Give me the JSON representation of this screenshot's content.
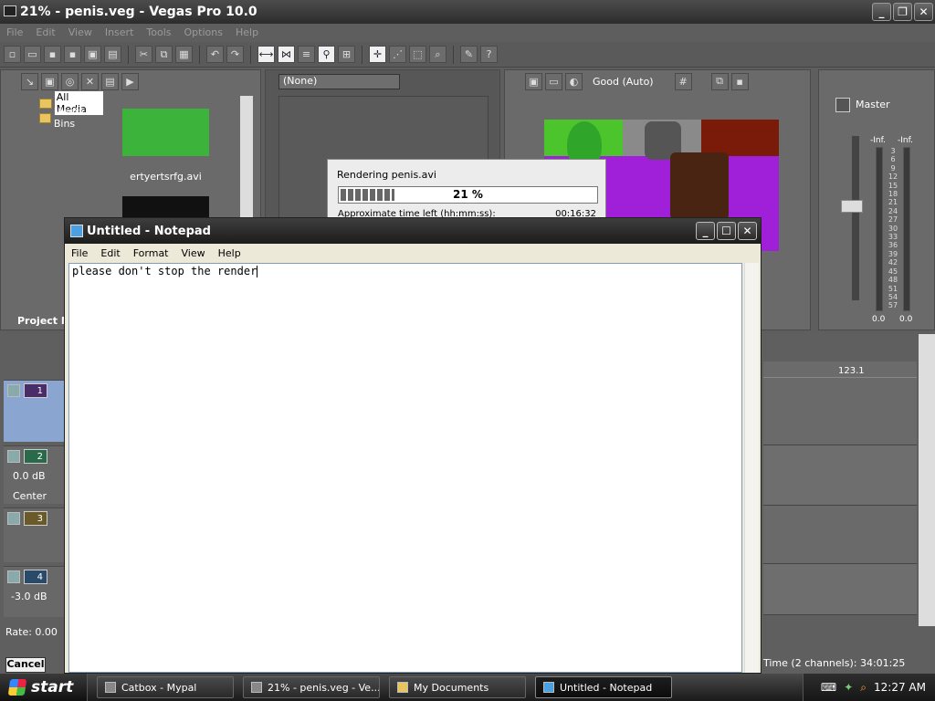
{
  "vegas": {
    "title": "21% - penis.veg - Vegas Pro 10.0",
    "menu": [
      "File",
      "Edit",
      "View",
      "Insert",
      "Tools",
      "Options",
      "Help"
    ],
    "media_tree": [
      "All Media",
      "Media Bins"
    ],
    "media_file": "ertyertsrfg.avi",
    "project_tab": "Project M",
    "preview_filter": "(None)",
    "preview_quality": "Good (Auto)",
    "mixer_master": "Master",
    "mixer_levels": [
      "-Inf.",
      "-Inf."
    ],
    "mixer_scale": [
      "3",
      "6",
      "9",
      "12",
      "15",
      "18",
      "21",
      "24",
      "27",
      "30",
      "33",
      "36",
      "39",
      "42",
      "45",
      "48",
      "51",
      "54",
      "57"
    ],
    "mixer_values": [
      "0.0",
      "0.0"
    ],
    "timeline_marker": "123.1",
    "tracks": [
      {
        "num": "1"
      },
      {
        "num": "2",
        "vol": "0.0 dB",
        "pan": "Center"
      },
      {
        "num": "3"
      },
      {
        "num": "4",
        "vol": "-3.0 dB"
      }
    ],
    "rate": "Rate: 0.00",
    "cancel": "Cancel",
    "status_time": "Time (2 channels): 34:01:25"
  },
  "render": {
    "title": "Rendering penis.avi",
    "percent_label": "21 %",
    "percent": 0.21,
    "time_left_label": "Approximate time left (hh:mm:ss):",
    "time_left": "00:16:32"
  },
  "notepad": {
    "title": "Untitled - Notepad",
    "menu": [
      "File",
      "Edit",
      "Format",
      "View",
      "Help"
    ],
    "text": "please don't stop the render"
  },
  "taskbar": {
    "start": "start",
    "tasks": [
      "Catbox - Mypal",
      "21% - penis.veg - Ve...",
      "My Documents",
      "Untitled - Notepad"
    ],
    "clock": "12:27 AM"
  },
  "colors": {
    "accent_green": "#3cb43c",
    "purple": "#9a2ecf",
    "notepad_bg": "#ffffff"
  }
}
